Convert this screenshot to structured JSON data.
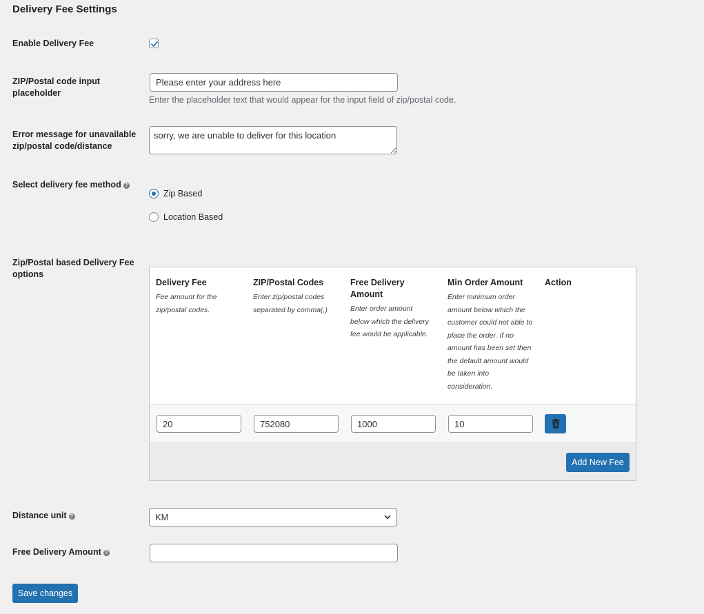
{
  "page_title": "Delivery Fee Settings",
  "enable_fee": {
    "label": "Enable Delivery Fee",
    "checked": true
  },
  "zip_placeholder": {
    "label": "ZIP/Postal code input placeholder",
    "value": "Please enter your address here",
    "description": "Enter the placeholder text that would appear for the input field of zip/postal code."
  },
  "error_message": {
    "label": "Error message for unavailable zip/postal code/distance",
    "value": "sorry, we are unable to deliver for this location"
  },
  "fee_method": {
    "label": "Select delivery fee method",
    "options": [
      {
        "label": "Zip Based",
        "selected": true
      },
      {
        "label": "Location Based",
        "selected": false
      }
    ]
  },
  "zip_options": {
    "label": "Zip/Postal based Delivery Fee options",
    "columns": [
      {
        "title": "Delivery Fee",
        "description": "Fee amount for the zip/postal codes."
      },
      {
        "title": "ZIP/Postal Codes",
        "description": "Enter zip/postal codes separated by comma(,)"
      },
      {
        "title": "Free Delivery Amount",
        "description": "Enter order amount below which the delivery fee would be applicable."
      },
      {
        "title": "Min Order Amount",
        "description": "Enter minimum order amount below which the customer could not able to place the order. If no amount has been set then the default amount would be taken into consideration."
      },
      {
        "title": "Action",
        "description": ""
      }
    ],
    "rows": [
      {
        "delivery_fee": "20",
        "zip_codes": "752080",
        "free_delivery_amount": "1000",
        "min_order_amount": "10"
      }
    ],
    "add_button": "Add New Fee"
  },
  "distance_unit": {
    "label": "Distance unit",
    "value": "KM"
  },
  "free_delivery_amount": {
    "label": "Free Delivery Amount",
    "value": ""
  },
  "save_button": "Save changes",
  "colors": {
    "primary": "#2271b1",
    "background": "#f0f0f1",
    "text": "#1d2327",
    "muted": "#646970"
  }
}
